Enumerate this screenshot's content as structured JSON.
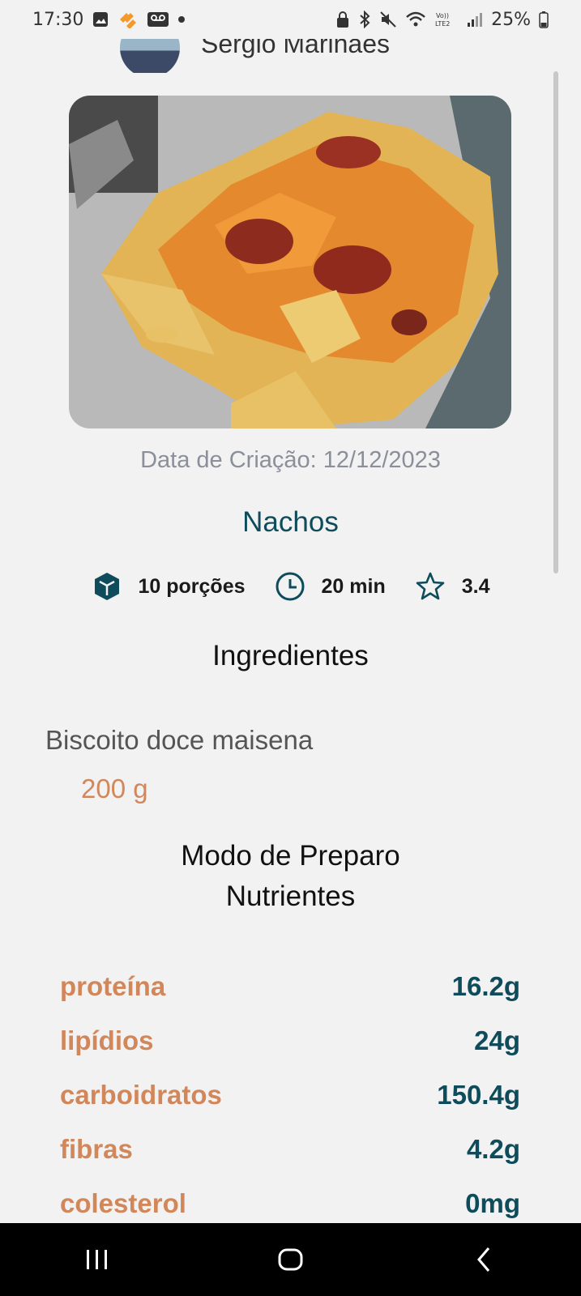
{
  "status_bar": {
    "time": "17:30",
    "battery": "25%",
    "icons_left": [
      "gallery-icon",
      "app-badge-icon",
      "voicemail-icon",
      "dot-icon"
    ],
    "icons_right": [
      "lock-icon",
      "bluetooth-icon",
      "mute-icon",
      "wifi-icon",
      "volte-icon",
      "signal-icon",
      "battery-icon"
    ]
  },
  "author": {
    "name": "Sergio Marinaes"
  },
  "recipe": {
    "creation_date": "Data de Criação: 12/12/2023",
    "title": "Nachos",
    "servings": "10 porções",
    "time": "20 min",
    "rating": "3.4"
  },
  "ingredients": {
    "heading": "Ingredientes",
    "items": [
      {
        "name": "Biscoito doce maisena",
        "quantity": "200 g"
      }
    ]
  },
  "preparation": {
    "heading": "Modo de Preparo"
  },
  "nutrients": {
    "heading": "Nutrientes",
    "items": [
      {
        "label": "proteína",
        "value": "16.2g"
      },
      {
        "label": "lipídios",
        "value": "24g"
      },
      {
        "label": "carboidratos",
        "value": "150.4g"
      },
      {
        "label": "fibras",
        "value": "4.2g"
      },
      {
        "label": "colesterol",
        "value": "0mg"
      }
    ]
  },
  "colors": {
    "primary": "#0e4c5c",
    "accent": "#d2875a",
    "background": "#f2f2f2"
  },
  "nav_bar": {
    "buttons": [
      "recents-icon",
      "home-icon",
      "back-icon"
    ]
  }
}
